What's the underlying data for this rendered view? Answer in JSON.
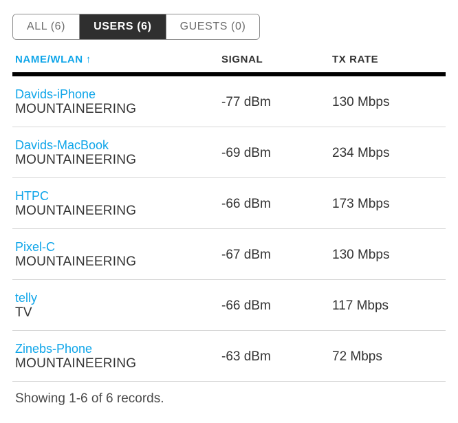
{
  "tabs": [
    {
      "id": "all",
      "label": "ALL (6)"
    },
    {
      "id": "users",
      "label": "USERS (6)"
    },
    {
      "id": "guests",
      "label": "GUESTS (0)"
    }
  ],
  "active_tab": "users",
  "columns": {
    "name": "NAME/WLAN",
    "signal": "SIGNAL",
    "tx": "TX RATE"
  },
  "sort_arrow": "↑",
  "rows": [
    {
      "device": "Davids-iPhone",
      "wlan": "MOUNTAINEERING",
      "signal": "-77 dBm",
      "tx": "130 Mbps"
    },
    {
      "device": "Davids-MacBook",
      "wlan": "MOUNTAINEERING",
      "signal": "-69 dBm",
      "tx": "234 Mbps"
    },
    {
      "device": "HTPC",
      "wlan": "MOUNTAINEERING",
      "signal": "-66 dBm",
      "tx": "173 Mbps"
    },
    {
      "device": "Pixel-C",
      "wlan": "MOUNTAINEERING",
      "signal": "-67 dBm",
      "tx": "130 Mbps"
    },
    {
      "device": "telly",
      "wlan": "TV",
      "signal": "-66 dBm",
      "tx": "117 Mbps"
    },
    {
      "device": "Zinebs-Phone",
      "wlan": "MOUNTAINEERING",
      "signal": "-63 dBm",
      "tx": "72 Mbps"
    }
  ],
  "footer": "Showing 1-6 of 6 records."
}
